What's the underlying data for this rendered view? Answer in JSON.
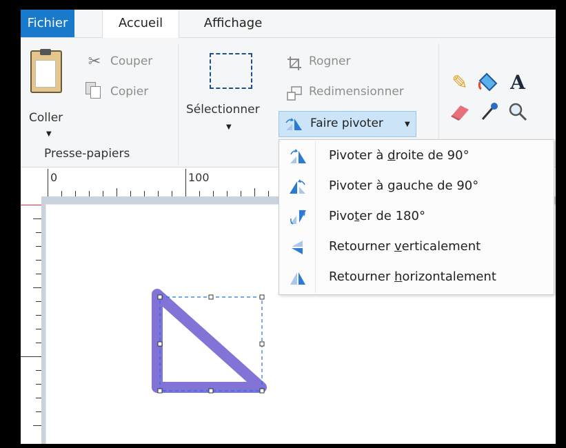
{
  "tabs": {
    "file": "Fichier",
    "home": "Accueil",
    "view": "Affichage"
  },
  "clipboard": {
    "paste": "Coller",
    "cut": "Couper",
    "copy": "Copier",
    "group": "Presse-papiers"
  },
  "image": {
    "select": "Sélectionner",
    "crop": "Rogner",
    "resize": "Redimensionner",
    "rotate": "Faire pivoter"
  },
  "ruler": {
    "h0": "0",
    "h100": "100"
  },
  "menu": {
    "items": [
      {
        "pre": "Pivoter à ",
        "key": "d",
        "post": "roite de 90°"
      },
      {
        "pre": "Pivoter à ",
        "key": "g",
        "post": "auche de 90°"
      },
      {
        "pre": "Pivo",
        "key": "t",
        "post": "er de 180°"
      },
      {
        "pre": "Retourner ",
        "key": "v",
        "post": "erticalement"
      },
      {
        "pre": "Retourner ",
        "key": "h",
        "post": "orizontalement"
      }
    ]
  },
  "colors": {
    "file_tab": "#1979ca",
    "triangle": "#8174d6",
    "selection": "#1a73e8"
  }
}
